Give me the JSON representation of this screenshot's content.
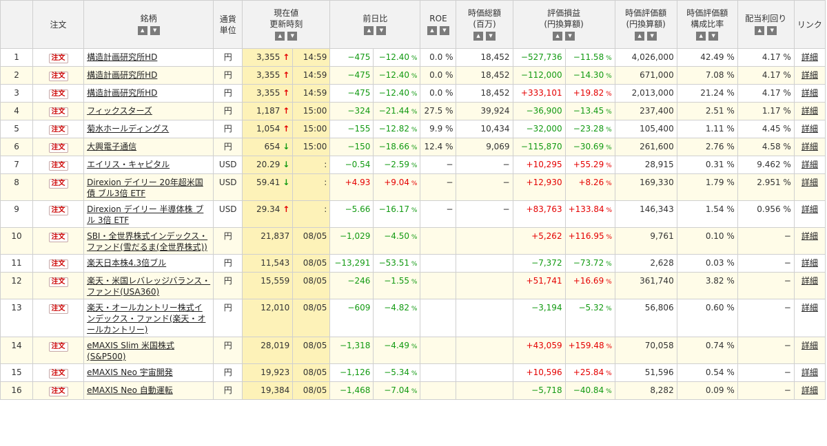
{
  "header": {
    "no": "",
    "order": "注文",
    "name": "銘柄",
    "currency": "通貨\n単位",
    "price_time": "現在値\n更新時刻",
    "change": "前日比",
    "roe": "ROE",
    "market_cap": "時価総額\n(百万)",
    "pl": "評価損益\n(円換算額)",
    "value": "時価評価額\n(円換算額)",
    "ratio": "時価評価額\n構成比率",
    "dividend": "配当利回り",
    "link": "リンク"
  },
  "sort_icons": {
    "asc": "▲",
    "desc": "▼"
  },
  "order_label": "注文",
  "link_label": "詳細",
  "colors": {
    "up": "#e40000",
    "down": "#129a12",
    "price_bg": "#fdf2b8",
    "row_alt": "#fffce8",
    "header_bg": "#f2f2f2"
  },
  "rows": [
    {
      "no": "1",
      "name": "構造計画研究所HD",
      "currency": "円",
      "price": "3,355",
      "arrow": "↑",
      "time": "14:59",
      "chg": "−475",
      "chg_pct": "−12.40",
      "roe": "0.0 %",
      "cap": "18,452",
      "pl": "−527,736",
      "pl_pct": "−11.58",
      "value": "4,026,000",
      "ratio": "42.49 %",
      "div": "4.17 %"
    },
    {
      "no": "2",
      "name": "構造計画研究所HD",
      "currency": "円",
      "price": "3,355",
      "arrow": "↑",
      "time": "14:59",
      "chg": "−475",
      "chg_pct": "−12.40",
      "roe": "0.0 %",
      "cap": "18,452",
      "pl": "−112,000",
      "pl_pct": "−14.30",
      "value": "671,000",
      "ratio": "7.08 %",
      "div": "4.17 %"
    },
    {
      "no": "3",
      "name": "構造計画研究所HD",
      "currency": "円",
      "price": "3,355",
      "arrow": "↑",
      "time": "14:59",
      "chg": "−475",
      "chg_pct": "−12.40",
      "roe": "0.0 %",
      "cap": "18,452",
      "pl": "+333,101",
      "pl_pct": "+19.82",
      "value": "2,013,000",
      "ratio": "21.24 %",
      "div": "4.17 %"
    },
    {
      "no": "4",
      "name": "フィックスターズ",
      "currency": "円",
      "price": "1,187",
      "arrow": "↑",
      "time": "15:00",
      "chg": "−324",
      "chg_pct": "−21.44",
      "roe": "27.5 %",
      "cap": "39,924",
      "pl": "−36,900",
      "pl_pct": "−13.45",
      "value": "237,400",
      "ratio": "2.51 %",
      "div": "1.17 %"
    },
    {
      "no": "5",
      "name": "菊水ホールディングス",
      "currency": "円",
      "price": "1,054",
      "arrow": "↑",
      "time": "15:00",
      "chg": "−155",
      "chg_pct": "−12.82",
      "roe": "9.9 %",
      "cap": "10,434",
      "pl": "−32,000",
      "pl_pct": "−23.28",
      "value": "105,400",
      "ratio": "1.11 %",
      "div": "4.45 %"
    },
    {
      "no": "6",
      "name": "大興電子通信",
      "currency": "円",
      "price": "654",
      "arrow": "↓",
      "time": "15:00",
      "chg": "−150",
      "chg_pct": "−18.66",
      "roe": "12.4 %",
      "cap": "9,069",
      "pl": "−115,870",
      "pl_pct": "−30.69",
      "value": "261,600",
      "ratio": "2.76 %",
      "div": "4.58 %"
    },
    {
      "no": "7",
      "name": "エイリス・キャピタル",
      "currency": "USD",
      "price": "20.29",
      "arrow": "↓",
      "time": ":",
      "chg": "−0.54",
      "chg_pct": "−2.59",
      "roe": "−",
      "cap": "−",
      "pl": "+10,295",
      "pl_pct": "+55.29",
      "value": "28,915",
      "ratio": "0.31 %",
      "div": "9.462 %"
    },
    {
      "no": "8",
      "name": "Direxion デイリー 20年超米国債 ブル3倍 ETF",
      "currency": "USD",
      "price": "59.41",
      "arrow": "↓",
      "time": ":",
      "chg": "+4.93",
      "chg_pct": "+9.04",
      "roe": "−",
      "cap": "−",
      "pl": "+12,930",
      "pl_pct": "+8.26",
      "value": "169,330",
      "ratio": "1.79 %",
      "div": "2.951 %"
    },
    {
      "no": "9",
      "name": "Direxion デイリー 半導体株 ブル 3倍 ETF",
      "currency": "USD",
      "price": "29.34",
      "arrow": "↑",
      "time": ":",
      "chg": "−5.66",
      "chg_pct": "−16.17",
      "roe": "−",
      "cap": "−",
      "pl": "+83,763",
      "pl_pct": "+133.84",
      "value": "146,343",
      "ratio": "1.54 %",
      "div": "0.956 %"
    },
    {
      "no": "10",
      "name": "SBI・全世界株式インデックス・ファンド(雪だるま(全世界株式))",
      "currency": "円",
      "price": "21,837",
      "arrow": "",
      "time": "08/05",
      "chg": "−1,029",
      "chg_pct": "−4.50",
      "roe": "",
      "cap": "",
      "pl": "+5,262",
      "pl_pct": "+116.95",
      "value": "9,761",
      "ratio": "0.10 %",
      "div": "−"
    },
    {
      "no": "11",
      "name": "楽天日本株4.3倍ブル",
      "currency": "円",
      "price": "11,543",
      "arrow": "",
      "time": "08/05",
      "chg": "−13,291",
      "chg_pct": "−53.51",
      "roe": "",
      "cap": "",
      "pl": "−7,372",
      "pl_pct": "−73.72",
      "value": "2,628",
      "ratio": "0.03 %",
      "div": "−"
    },
    {
      "no": "12",
      "name": "楽天・米国レバレッジバランス・ファンド(USA360)",
      "currency": "円",
      "price": "15,559",
      "arrow": "",
      "time": "08/05",
      "chg": "−246",
      "chg_pct": "−1.55",
      "roe": "",
      "cap": "",
      "pl": "+51,741",
      "pl_pct": "+16.69",
      "value": "361,740",
      "ratio": "3.82 %",
      "div": "−"
    },
    {
      "no": "13",
      "name": "楽天・オールカントリー株式インデックス・ファンド(楽天・オールカントリー)",
      "currency": "円",
      "price": "12,010",
      "arrow": "",
      "time": "08/05",
      "chg": "−609",
      "chg_pct": "−4.82",
      "roe": "",
      "cap": "",
      "pl": "−3,194",
      "pl_pct": "−5.32",
      "value": "56,806",
      "ratio": "0.60 %",
      "div": "−"
    },
    {
      "no": "14",
      "name": "eMAXIS Slim 米国株式(S&P500)",
      "currency": "円",
      "price": "28,019",
      "arrow": "",
      "time": "08/05",
      "chg": "−1,318",
      "chg_pct": "−4.49",
      "roe": "",
      "cap": "",
      "pl": "+43,059",
      "pl_pct": "+159.48",
      "value": "70,058",
      "ratio": "0.74 %",
      "div": "−"
    },
    {
      "no": "15",
      "name": "eMAXIS Neo 宇宙開発",
      "currency": "円",
      "price": "19,923",
      "arrow": "",
      "time": "08/05",
      "chg": "−1,126",
      "chg_pct": "−5.34",
      "roe": "",
      "cap": "",
      "pl": "+10,596",
      "pl_pct": "+25.84",
      "value": "51,596",
      "ratio": "0.54 %",
      "div": "−"
    },
    {
      "no": "16",
      "name": "eMAXIS Neo 自動運転",
      "currency": "円",
      "price": "19,384",
      "arrow": "",
      "time": "08/05",
      "chg": "−1,468",
      "chg_pct": "−7.04",
      "roe": "",
      "cap": "",
      "pl": "−5,718",
      "pl_pct": "−40.84",
      "value": "8,282",
      "ratio": "0.09 %",
      "div": "−"
    }
  ]
}
